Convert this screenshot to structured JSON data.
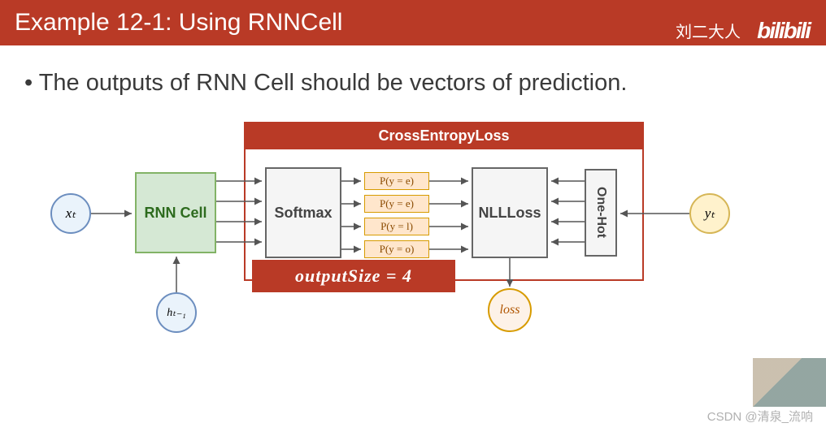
{
  "header": {
    "title": "Example 12-1: Using RNNCell",
    "author": "刘二大人",
    "logo": "bilibili"
  },
  "bullet": "The outputs of RNN Cell should be vectors of prediction.",
  "diagram": {
    "input_x": "xₜ",
    "hidden_prev": "hₜ₋₁",
    "rnn_cell": "RNN Cell",
    "cel_container": "CrossEntropyLoss",
    "softmax": "Softmax",
    "probs": [
      "P(y = e)",
      "P(y = e)",
      "P(y = l)",
      "P(y = o)"
    ],
    "nllloss": "NLLLoss",
    "onehot": "One-Hot",
    "target_y": "yₜ",
    "loss_out": "loss",
    "formula": "outputSize  =  4"
  },
  "watermarks": {
    "csdn": "CSDN @清泉_流响"
  }
}
